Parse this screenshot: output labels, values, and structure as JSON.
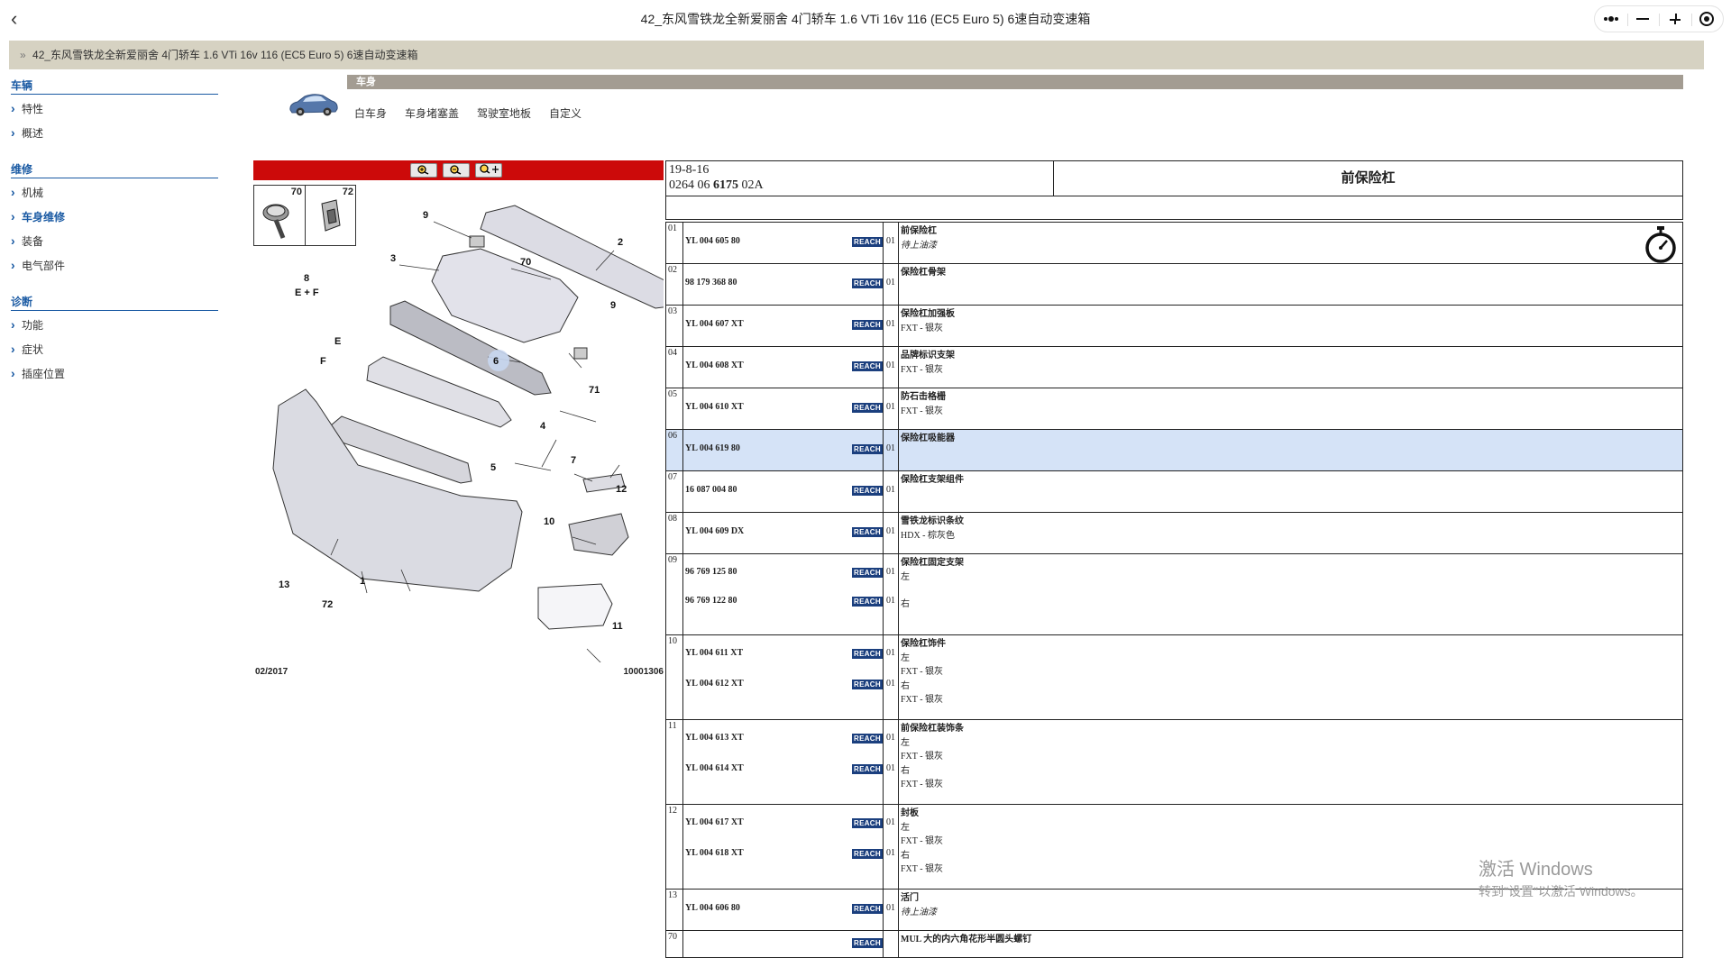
{
  "window": {
    "title": "42_东风雪铁龙全新爱丽舍 4门轿车 1.6 VTi 16v 116 (EC5 Euro 5) 6速自动变速箱",
    "back_icon": "‹"
  },
  "breadcrumb": {
    "prefix": "»",
    "text": "42_东风雪铁龙全新爱丽舍 4门轿车 1.6 VTi 16v 116 (EC5 Euro 5) 6速自动变速箱"
  },
  "sidebar": {
    "sections": [
      {
        "title": "车辆",
        "items": [
          "特性",
          "概述"
        ]
      },
      {
        "title": "维修",
        "items": [
          "机械",
          "车身维修",
          "装备",
          "电气部件"
        ]
      },
      {
        "title": "诊断",
        "items": [
          "功能",
          "症状",
          "插座位置"
        ]
      }
    ]
  },
  "category": {
    "bar_label": "车身",
    "tabs": [
      "白车身",
      "车身堵塞盖",
      "驾驶室地板",
      "自定义"
    ]
  },
  "diagram": {
    "thumbs": [
      "70",
      "72"
    ],
    "callouts": [
      "9",
      "2",
      "3",
      "70",
      "8",
      "E + F",
      "9",
      "6",
      "E",
      "F",
      "71",
      "4",
      "5",
      "7",
      "12",
      "10",
      "13",
      "72",
      "1",
      "11"
    ],
    "date": "02/2017",
    "code": "10001306"
  },
  "parts_header": {
    "date": "19-8-16",
    "ref_prefix": "0264 06 ",
    "ref_bold": "6175",
    "ref_suffix": " 02A",
    "title": "前保险杠"
  },
  "reach_label": "REACH",
  "rows": [
    {
      "idx": "01",
      "parts": [
        "YL 004 605 80"
      ],
      "qty": [
        "01"
      ],
      "name": "前保险杠",
      "lines": [
        {
          "t": "待上油漆",
          "i": true
        }
      ],
      "timer": true
    },
    {
      "idx": "02",
      "parts": [
        "98 179 368 80"
      ],
      "qty": [
        "01"
      ],
      "name": "保险杠骨架",
      "lines": []
    },
    {
      "idx": "03",
      "parts": [
        "YL 004 607 XT"
      ],
      "qty": [
        "01"
      ],
      "name": "保险杠加强板",
      "lines": [
        {
          "t": "FXT - 银灰"
        }
      ]
    },
    {
      "idx": "04",
      "parts": [
        "YL 004 608 XT"
      ],
      "qty": [
        "01"
      ],
      "name": "品牌标识支架",
      "lines": [
        {
          "t": "FXT - 银灰"
        }
      ]
    },
    {
      "idx": "05",
      "parts": [
        "YL 004 610 XT"
      ],
      "qty": [
        "01"
      ],
      "name": "防石击格栅",
      "lines": [
        {
          "t": "FXT - 银灰"
        }
      ]
    },
    {
      "idx": "06",
      "parts": [
        "YL 004 619 80"
      ],
      "qty": [
        "01"
      ],
      "name": "保险杠吸能器",
      "lines": [],
      "highlight": true
    },
    {
      "idx": "07",
      "parts": [
        "16 087 004 80"
      ],
      "qty": [
        "01"
      ],
      "name": "保险杠支架组件",
      "lines": []
    },
    {
      "idx": "08",
      "parts": [
        "YL 004 609 DX"
      ],
      "qty": [
        "01"
      ],
      "name": "雪铁龙标识条纹",
      "lines": [
        {
          "t": "HDX - 棕灰色"
        }
      ]
    },
    {
      "idx": "09",
      "parts": [
        "96 769 125 80",
        "96 769 122 80"
      ],
      "qty": [
        "01",
        "01"
      ],
      "name": "保险杠固定支架",
      "lines": [
        {
          "t": "左"
        },
        {
          "t": ""
        },
        {
          "t": "右"
        }
      ]
    },
    {
      "idx": "10",
      "parts": [
        "YL 004 611 XT",
        "YL 004 612 XT"
      ],
      "qty": [
        "01",
        "01"
      ],
      "name": "保险杠饰件",
      "lines": [
        {
          "t": "左"
        },
        {
          "t": "FXT - 银灰"
        },
        {
          "t": "右"
        },
        {
          "t": "FXT - 银灰"
        }
      ]
    },
    {
      "idx": "11",
      "parts": [
        "YL 004 613 XT",
        "YL 004 614 XT"
      ],
      "qty": [
        "01",
        "01"
      ],
      "name": "前保险杠装饰条",
      "lines": [
        {
          "t": "左"
        },
        {
          "t": "FXT - 银灰"
        },
        {
          "t": "右"
        },
        {
          "t": "FXT - 银灰"
        }
      ]
    },
    {
      "idx": "12",
      "parts": [
        "YL 004 617 XT",
        "YL 004 618 XT"
      ],
      "qty": [
        "01",
        "01"
      ],
      "name": "封板",
      "lines": [
        {
          "t": "左"
        },
        {
          "t": "FXT - 银灰"
        },
        {
          "t": "右"
        },
        {
          "t": "FXT - 银灰"
        }
      ]
    },
    {
      "idx": "13",
      "parts": [
        "YL 004 606 80"
      ],
      "qty": [
        "01"
      ],
      "name": "活门",
      "lines": [
        {
          "t": "待上油漆",
          "i": true
        }
      ]
    },
    {
      "idx": "70",
      "parts": [
        ""
      ],
      "qty": [
        ""
      ],
      "name": "MUL 大的内六角花形半圆头螺钉",
      "lines": []
    }
  ],
  "watermark": {
    "line1": "激活 Windows",
    "line2": "转到\"设置\"以激活 Windows。"
  },
  "colors": {
    "accent": "#1a5aa3",
    "zoom_bar": "#cc0a0a",
    "reach_badge": "#1b3f7e",
    "highlight_row": "#d5e3f7",
    "crumb_bg": "#d6d2c2"
  }
}
